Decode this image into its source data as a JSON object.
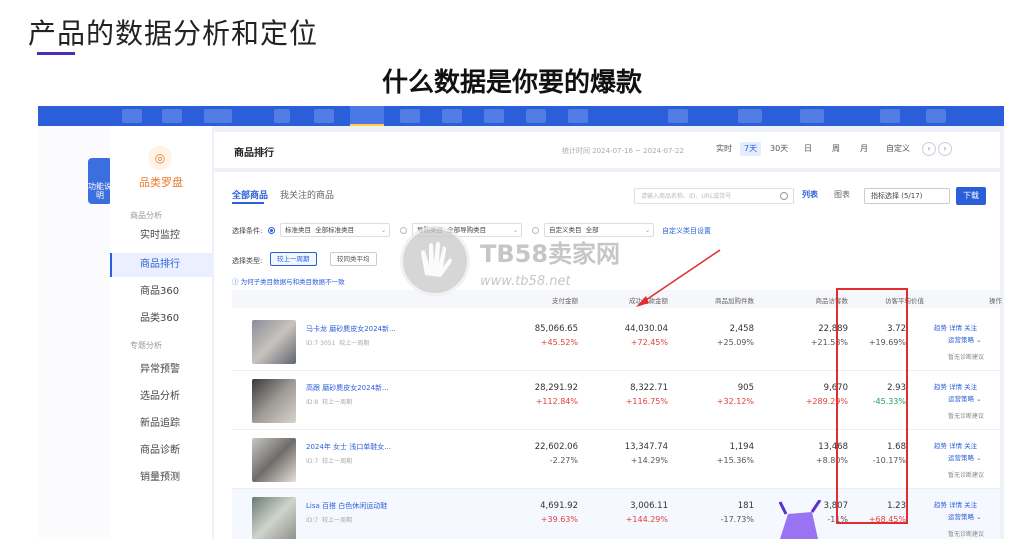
{
  "slide": {
    "title": "产品的数据分析和定位",
    "subtitle": "什么数据是你要的爆款"
  },
  "mascot_label": "功能说明",
  "sidebar": {
    "brand": "品类罗盘",
    "brand_icon": "compass-icon",
    "group1": "商品分析",
    "group2": "专题分析",
    "items": [
      {
        "label": "实时监控"
      },
      {
        "label": "商品排行"
      },
      {
        "label": "商品360"
      },
      {
        "label": "品类360"
      },
      {
        "label": "异常预警"
      },
      {
        "label": "选品分析"
      },
      {
        "label": "新品追踪"
      },
      {
        "label": "商品诊断"
      },
      {
        "label": "销量预测"
      }
    ]
  },
  "header": {
    "title": "商品排行",
    "date_range": "统计时间 2024-07-16 ~ 2024-07-22",
    "periods": [
      "实时",
      "7天",
      "30天",
      "日",
      "周",
      "月",
      "自定义"
    ],
    "active_period": "7天"
  },
  "tabs": {
    "all": "全部商品",
    "following": "我关注的商品"
  },
  "search": {
    "placeholder": "请输入商品名称、ID、URL或货号"
  },
  "view": {
    "list": "列表",
    "chart": "图表",
    "filter": "指标选择 (5/17)",
    "download": "下载"
  },
  "filters": {
    "row1_label": "选择条件:",
    "select1_label": "标准类目",
    "select1_value": "全部标准类目",
    "select2_label": "导购类目",
    "select2_value": "全部导购类目",
    "select3_label": "自定义类目",
    "select3_value": "全部",
    "custom_link": "自定义类目设置",
    "row2_label": "选择类型:",
    "chip_active": "较上一周期",
    "chip_other": "较同类平均",
    "tip": "为何子类目数据与和类目数据不一致"
  },
  "table": {
    "headers": [
      "支付金额",
      "成功退款金额",
      "商品加购件数",
      "商品访客数",
      "访客平均价值",
      "操作"
    ],
    "rows": [
      {
        "title": "马卡龙 磨砂麂皮女2024新...",
        "id": "ID:7   3051",
        "compare": "较上一周期",
        "pay": "85,066.65",
        "pay_chg": "+45.52%",
        "refund": "44,030.04",
        "refund_chg": "+72.45%",
        "cart": "2,458",
        "cart_chg": "+25.09%",
        "visitors": "22,889",
        "visitors_chg": "+21.58%",
        "avg": "3.72",
        "avg_chg": "+19.69%",
        "ops": [
          "趋势",
          "详情",
          "关注"
        ],
        "strategy": "运营策略",
        "note": "暂无诊断建议"
      },
      {
        "title": "高跟 磨砂麂皮女2024新...",
        "id": "ID:8",
        "compare": "较上一周期",
        "pay": "28,291.92",
        "pay_chg": "+112.84%",
        "refund": "8,322.71",
        "refund_chg": "+116.75%",
        "cart": "905",
        "cart_chg": "+32.12%",
        "visitors": "9,670",
        "visitors_chg": "+289.29%",
        "avg": "2.93",
        "avg_chg": "-45.33%",
        "ops": [
          "趋势",
          "详情",
          "关注"
        ],
        "strategy": "运营策略",
        "note": "暂无诊断建议"
      },
      {
        "title": "2024年 女士 浅口单鞋女...",
        "id": "ID:7",
        "compare": "较上一周期",
        "pay": "22,602.06",
        "pay_chg": "-2.27%",
        "refund": "13,347.74",
        "refund_chg": "+14.29%",
        "cart": "1,194",
        "cart_chg": "+15.36%",
        "visitors": "13,468",
        "visitors_chg": "+8.80%",
        "avg": "1.68",
        "avg_chg": "-10.17%",
        "ops": [
          "趋势",
          "详情",
          "关注"
        ],
        "strategy": "运营策略",
        "note": "暂无诊断建议"
      },
      {
        "title": "Lisa 百搭 白色休闲运动鞋",
        "id": "ID:7",
        "compare": "较上一周期",
        "pay": "4,691.92",
        "pay_chg": "+39.63%",
        "refund": "3,006.11",
        "refund_chg": "+144.29%",
        "cart": "181",
        "cart_chg": "-17.73%",
        "visitors": "3,807",
        "visitors_chg": "-11%",
        "avg": "1.23",
        "avg_chg": "+68.45%",
        "ops": [
          "趋势",
          "详情",
          "关注"
        ],
        "strategy": "运营策略",
        "note": "暂无诊断建议"
      }
    ]
  },
  "watermark": {
    "text": "TB58卖家网",
    "url": "www.tb58.net"
  },
  "colors": {
    "brand_blue": "#2b5fd9",
    "highlight_red": "#e02d2d",
    "up_red": "#e0403c",
    "down_green": "#19a35a"
  }
}
